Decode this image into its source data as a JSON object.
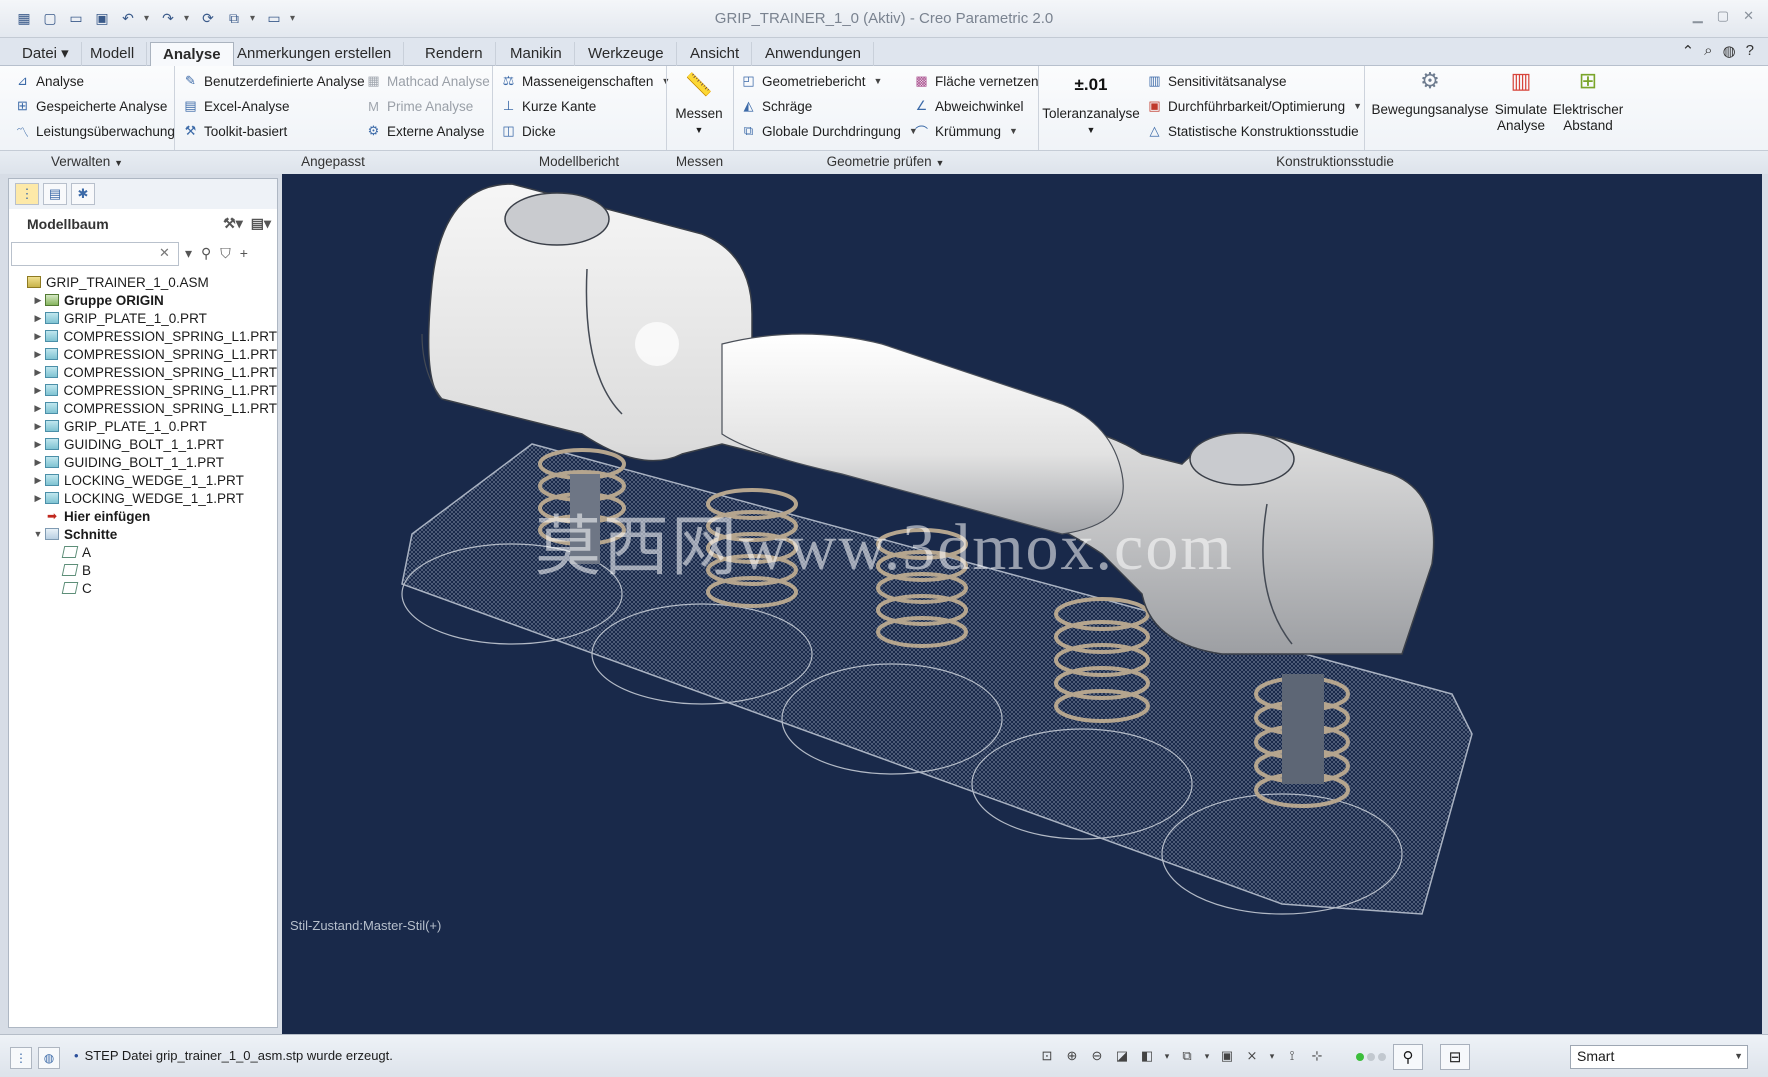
{
  "titlebar": {
    "title": "GRIP_TRAINER_1_0 (Aktiv) - Creo Parametric 2.0"
  },
  "tabs": [
    {
      "label": "Datei ▾"
    },
    {
      "label": "Modell"
    },
    {
      "label": "Analyse"
    },
    {
      "label": "Anmerkungen erstellen"
    },
    {
      "label": "Rendern"
    },
    {
      "label": "Manikin"
    },
    {
      "label": "Werkzeuge"
    },
    {
      "label": "Ansicht"
    },
    {
      "label": "Anwendungen"
    }
  ],
  "ribbon": {
    "verwalten": {
      "items": [
        "Analyse",
        "Gespeicherte Analyse",
        "Leistungsüberwachung"
      ],
      "group": "Verwalten"
    },
    "angepasst": {
      "col1": [
        "Benutzerdefinierte Analyse",
        "Excel-Analyse",
        "Toolkit-basiert"
      ],
      "col2": [
        "Mathcad Analyse",
        "Prime Analyse",
        "Externe Analyse"
      ],
      "group": "Angepasst"
    },
    "modellbericht": {
      "items": [
        "Masseneigenschaften",
        "Kurze Kante",
        "Dicke"
      ],
      "group": "Modellbericht"
    },
    "messen": {
      "button": "Messen",
      "group": "Messen"
    },
    "geometrie": {
      "col1": [
        "Geometriebericht",
        "Schräge",
        "Globale Durchdringung"
      ],
      "col2": [
        "Fläche vernetzen",
        "Abweichwinkel",
        "Krümmung"
      ],
      "group": "Geometrie prüfen"
    },
    "toleranz": {
      "icon_text": "±.01",
      "label": "Toleranzanalyse"
    },
    "studie": {
      "items": [
        "Sensitivitätsanalyse",
        "Durchführbarkeit/Optimierung",
        "Statistische Konstruktionsstudie"
      ],
      "group": "Konstruktionsstudie"
    },
    "bewegung": {
      "label": "Bewegungsanalyse"
    },
    "simulate": {
      "line1": "Simulate",
      "line2": "Analyse"
    },
    "elektrisch": {
      "line1": "Elektrischer",
      "line2": "Abstand"
    }
  },
  "modelltree": {
    "title": "Modellbaum",
    "search_value": "",
    "items": [
      {
        "label": "GRIP_TRAINER_1_0.ASM",
        "level": 0,
        "kind": "asm",
        "arrow": ""
      },
      {
        "label": "Gruppe ORIGIN",
        "level": 1,
        "kind": "grp",
        "arrow": "▶"
      },
      {
        "label": "GRIP_PLATE_1_0.PRT",
        "level": 1,
        "kind": "prt",
        "arrow": "▶"
      },
      {
        "label": "COMPRESSION_SPRING_L1.PRT",
        "level": 1,
        "kind": "prt",
        "arrow": "▶"
      },
      {
        "label": "COMPRESSION_SPRING_L1.PRT",
        "level": 1,
        "kind": "prt",
        "arrow": "▶"
      },
      {
        "label": "COMPRESSION_SPRING_L1.PRT",
        "level": 1,
        "kind": "prt",
        "arrow": "▶"
      },
      {
        "label": "COMPRESSION_SPRING_L1.PRT",
        "level": 1,
        "kind": "prt",
        "arrow": "▶"
      },
      {
        "label": "COMPRESSION_SPRING_L1.PRT",
        "level": 1,
        "kind": "prt",
        "arrow": "▶"
      },
      {
        "label": "GRIP_PLATE_1_0.PRT",
        "level": 1,
        "kind": "prt",
        "arrow": "▶"
      },
      {
        "label": "GUIDING_BOLT_1_1.PRT",
        "level": 1,
        "kind": "prt",
        "arrow": "▶"
      },
      {
        "label": "GUIDING_BOLT_1_1.PRT",
        "level": 1,
        "kind": "prt",
        "arrow": "▶"
      },
      {
        "label": "LOCKING_WEDGE_1_1.PRT",
        "level": 1,
        "kind": "prt",
        "arrow": "▶"
      },
      {
        "label": "LOCKING_WEDGE_1_1.PRT",
        "level": 1,
        "kind": "prt",
        "arrow": "▶"
      },
      {
        "label": "Hier einfügen",
        "level": 1,
        "kind": "insert",
        "arrow": ""
      },
      {
        "label": "Schnitte",
        "level": 1,
        "kind": "folder",
        "arrow": "▼"
      },
      {
        "label": "A",
        "level": 2,
        "kind": "sec",
        "arrow": ""
      },
      {
        "label": "B",
        "level": 2,
        "kind": "sec",
        "arrow": ""
      },
      {
        "label": "C",
        "level": 2,
        "kind": "sec",
        "arrow": ""
      }
    ]
  },
  "viewport": {
    "style_state": "Stil-Zustand:Master-Stil(+)",
    "watermark": "莫西网www.3dmox.com",
    "background": "#19294a"
  },
  "statusbar": {
    "message": "STEP Datei grip_trainer_1_0_asm.stp wurde erzeugt.",
    "filter": "Smart"
  }
}
